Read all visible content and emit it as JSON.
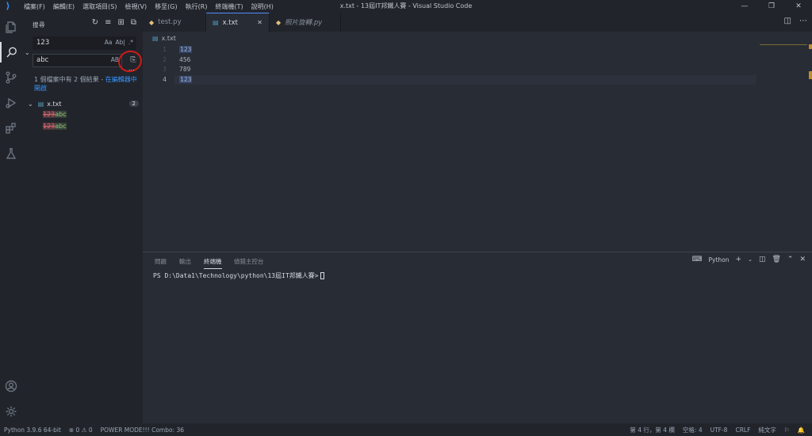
{
  "titlebar": {
    "menu": [
      "檔案(F)",
      "編輯(E)",
      "選取項目(S)",
      "檢視(V)",
      "移至(G)",
      "執行(R)",
      "終端機(T)",
      "說明(H)"
    ],
    "title": "x.txt - 13屆IT邦鐵人賽 - Visual Studio Code",
    "buttons": [
      "—",
      "❐",
      "✕"
    ]
  },
  "activity_bar": [
    "explorer",
    "search",
    "source-control",
    "run-debug",
    "extensions",
    "testing",
    "accounts",
    "settings"
  ],
  "sidebar": {
    "title": "搜尋",
    "search_value": "123",
    "search_opts": [
      "Aa",
      "Ab|",
      ".*"
    ],
    "replace_value": "abc",
    "replace_opt": "AB",
    "more": "...",
    "results_text": "1 個檔案中有 2 個結果 - ",
    "results_link": "在編輯器中開啟",
    "file_name": "x.txt",
    "file_count": "2",
    "matches": [
      {
        "old": "123",
        "new": "abc"
      },
      {
        "old": "123",
        "new": "abc"
      }
    ]
  },
  "tabs": [
    {
      "label": "test.py",
      "icon": "python-icon",
      "active": false
    },
    {
      "label": "x.txt",
      "icon": "file-icon",
      "active": true
    },
    {
      "label": "照片旋轉.py",
      "icon": "python-icon",
      "active": false
    }
  ],
  "editor": {
    "breadcrumb": "x.txt",
    "lines": [
      {
        "num": "1",
        "text": "123"
      },
      {
        "num": "2",
        "text": "456"
      },
      {
        "num": "3",
        "text": "789"
      },
      {
        "num": "4",
        "text": "123"
      }
    ]
  },
  "panel": {
    "tabs": [
      "問題",
      "輸出",
      "終端機",
      "偵錯主控台"
    ],
    "active_tab": "終端機",
    "terminal_type": "Python",
    "terminal_line": "PS D:\\Data1\\Technology\\python\\13屆IT邦鐵人賽>"
  },
  "statusbar": {
    "python": "Python 3.9.6 64-bit",
    "errors": "⊗ 0 ⚠ 0",
    "power_mode": "POWER MODE!!! Combo: 36",
    "position": "第 4 行，第 4 欄",
    "spaces": "空格: 4",
    "encoding": "UTF-8",
    "eol": "CRLF",
    "language": "純文字"
  }
}
